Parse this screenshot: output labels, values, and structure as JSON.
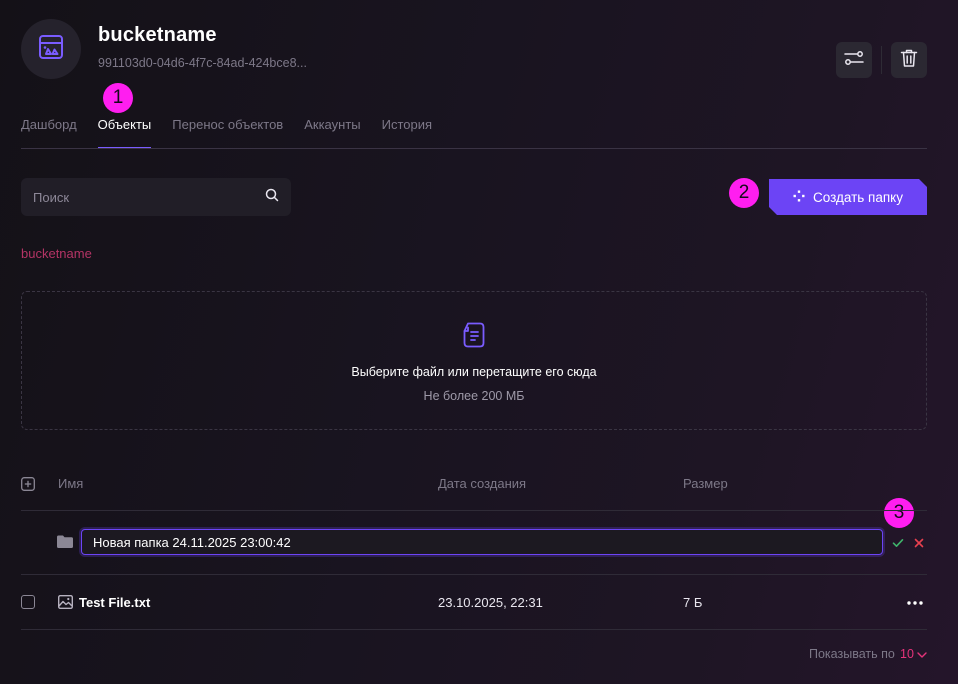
{
  "header": {
    "title": "bucketname",
    "bucket_id": "991103d0-04d6-4f7c-84ad-424bce8..."
  },
  "tabs": [
    {
      "label": "Дашборд",
      "active": false
    },
    {
      "label": "Объекты",
      "active": true
    },
    {
      "label": "Перенос объектов",
      "active": false
    },
    {
      "label": "Аккаунты",
      "active": false
    },
    {
      "label": "История",
      "active": false
    }
  ],
  "markers": [
    "1",
    "2",
    "3"
  ],
  "search": {
    "placeholder": "Поиск",
    "value": ""
  },
  "toolbar": {
    "create_folder_label": "Создать папку"
  },
  "breadcrumb": "bucketname",
  "dropzone": {
    "title": "Выберите файл или перетащите его сюда",
    "subtitle": "Не более 200 МБ"
  },
  "table": {
    "columns": [
      "Имя",
      "Дата создания",
      "Размер"
    ],
    "new_folder": {
      "value": "Новая папка 24.11.2025 23:00:42"
    },
    "rows": [
      {
        "name": "Test File.txt",
        "created": "23.10.2025, 22:31",
        "size": "7 Б"
      }
    ]
  },
  "pagination": {
    "label": "Показывать по",
    "page_size": "10"
  },
  "colors": {
    "accent": "#6c44f5",
    "marker": "#ff1ef0",
    "link": "#b43465",
    "confirm": "#3fb36b",
    "cancel": "#e8404f",
    "pager": "#e6337a"
  },
  "icons": [
    "bucket-icon",
    "settings-sliders-icon",
    "trash-icon",
    "search-icon",
    "sparkle-icon",
    "file-document-icon",
    "folder-icon",
    "image-icon",
    "check-icon",
    "close-icon",
    "more-icon",
    "chevron-down-icon",
    "plus-box-icon"
  ]
}
